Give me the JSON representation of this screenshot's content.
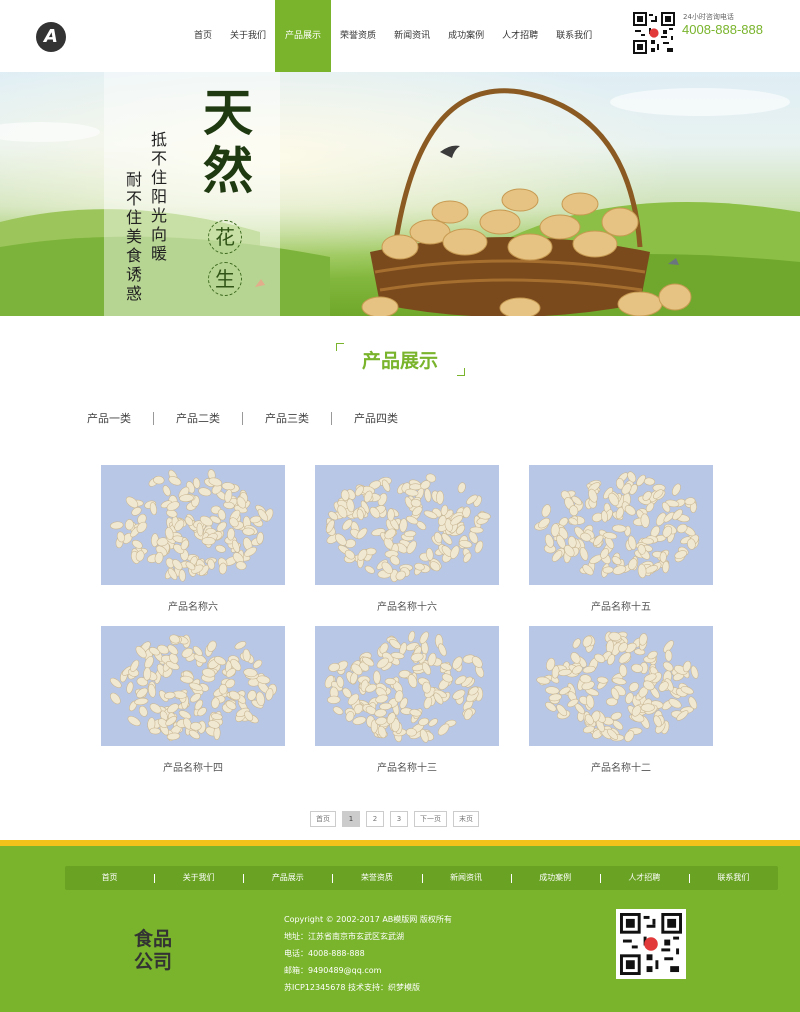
{
  "header": {
    "logo_letter": "A",
    "nav": [
      "首页",
      "关于我们",
      "产品展示",
      "荣誉资质",
      "新闻资讯",
      "成功案例",
      "人才招聘",
      "联系我们"
    ],
    "active_index": 2,
    "hotline_label": "24小时咨询电话",
    "hotline_number": "4008-888-888",
    "qr_icon": "qr-code-icon"
  },
  "banner": {
    "tagline_a": "抵不住阳光向暖",
    "tagline_b": "耐不住美食诱惑",
    "headline": "天然",
    "circle_1": "花",
    "circle_2": "生"
  },
  "section": {
    "title": "产品展示",
    "categories": [
      "产品一类",
      "产品二类",
      "产品三类",
      "产品四类"
    ]
  },
  "products": [
    {
      "name": "产品名称六"
    },
    {
      "name": "产品名称十六"
    },
    {
      "name": "产品名称十五"
    },
    {
      "name": "产品名称十四"
    },
    {
      "name": "产品名称十三"
    },
    {
      "name": "产品名称十二"
    }
  ],
  "pager": {
    "first": "首页",
    "pages": [
      "1",
      "2",
      "3"
    ],
    "current": "1",
    "next": "下一页",
    "last": "末页"
  },
  "footer": {
    "nav": [
      "首页",
      "关于我们",
      "产品展示",
      "荣誉资质",
      "新闻资讯",
      "成功案例",
      "人才招聘",
      "联系我们"
    ],
    "logo_text": "食品公司",
    "copyright": "Copyright © 2002-2017 AB模版网 版权所有",
    "address": "地址：江苏省南京市玄武区玄武湖",
    "phone": "电话：4008-888-888",
    "email": "邮箱：9490489@qq.com",
    "icp": "苏ICP12345678   技术支持：织梦模版"
  },
  "colors": {
    "accent": "#79b42c",
    "footer_stripe": "#f2c21a"
  }
}
